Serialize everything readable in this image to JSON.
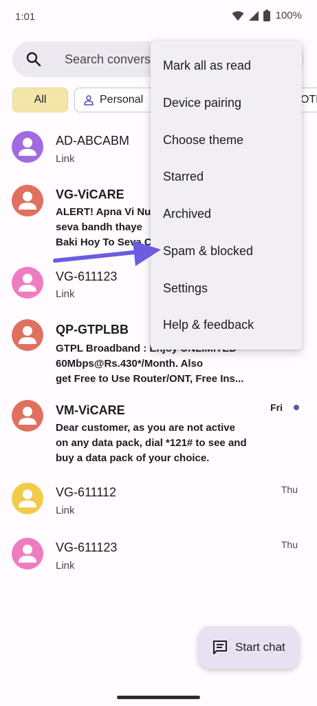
{
  "status_bar": {
    "time": "1:01",
    "battery": "100%"
  },
  "search": {
    "placeholder": "Search conversations"
  },
  "filters": [
    {
      "label": "All",
      "selected": true
    },
    {
      "label": "Personal",
      "selected": false
    },
    {
      "label": "OTPs",
      "selected": false
    }
  ],
  "conversations": [
    {
      "name": "AD-ABCABM",
      "snippet": "Link",
      "time": "",
      "unread": false,
      "avatar_color": "#a06be0"
    },
    {
      "name": "VG-ViCARE",
      "snippet": "ALERT! Apna Vi Nu\nseva bandh thaye\nBaki Hoy To Seva C",
      "time": "",
      "unread": true,
      "avatar_color": "#e0705f"
    },
    {
      "name": "VG-611123",
      "snippet": "Link",
      "time": "",
      "unread": false,
      "avatar_color": "#ee7cc1"
    },
    {
      "name": "QP-GTPLBB",
      "snippet": "GTPL Broadband : Enjoy UNLIMITED\n60Mbps@Rs.430*/Month. Also\nget Free to Use Router/ONT, Free Ins...",
      "time": "",
      "unread": true,
      "avatar_color": "#e0705f"
    },
    {
      "name": "VM-ViCARE",
      "snippet": "Dear customer, as you are not active\non any data pack, dial *121# to see and\nbuy a data pack of your choice.",
      "time": "Fri",
      "unread": true,
      "avatar_color": "#e0705f"
    },
    {
      "name": "VG-611112",
      "snippet": "Link",
      "time": "Thu",
      "unread": false,
      "avatar_color": "#f2cb4b"
    },
    {
      "name": "VG-611123",
      "snippet": "Link",
      "time": "Thu",
      "unread": false,
      "avatar_color": "#ee7cc1"
    }
  ],
  "menu": {
    "items": [
      "Mark all as read",
      "Device pairing",
      "Choose theme",
      "Starred",
      "Archived",
      "Spam & blocked",
      "Settings",
      "Help & feedback"
    ]
  },
  "fab": {
    "label": "Start chat",
    "icon": "chat-icon"
  },
  "colors": {
    "accent": "#6c5ce7",
    "arrow": "#6b5ce0"
  }
}
